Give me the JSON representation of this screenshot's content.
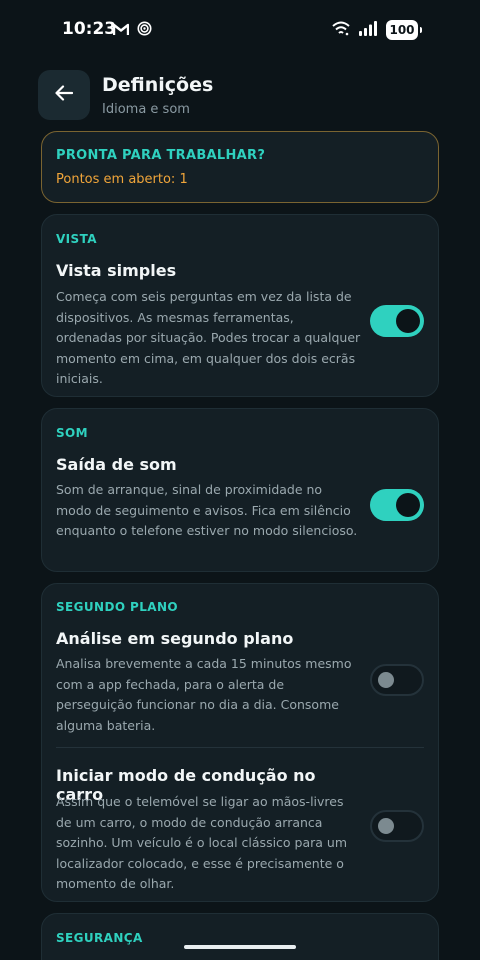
{
  "status_bar": {
    "time": "10:23",
    "battery": "100",
    "icons": [
      "gmail-icon",
      "hotspot-icon",
      "wifi-icon",
      "signal-icon",
      "battery-icon"
    ]
  },
  "header": {
    "back_icon": "arrow-left-icon",
    "title": "Definições",
    "subtitle": "Idioma e som"
  },
  "ready_card": {
    "title": "PRONTA PARA TRABALHAR?",
    "open_points": "Pontos em aberto: 1"
  },
  "sections": {
    "vista": {
      "label": "VISTA",
      "title": "Vista simples",
      "description": "Começa com seis perguntas em vez da lista de dispositivos. As mesmas ferramentas, ordenadas por situação. Podes trocar a qualquer momento em cima, em qualquer dos dois ecrãs iniciais.",
      "enabled": true
    },
    "som": {
      "label": "SOM",
      "title": "Saída de som",
      "description": "Som de arranque, sinal de proximidade no modo de seguimento e avisos. Fica em silêncio enquanto o telefone estiver no modo silencioso.",
      "enabled": true
    },
    "segundo_plano": {
      "label": "SEGUNDO PLANO",
      "items": [
        {
          "title": "Análise em segundo plano",
          "description": "Analisa brevemente a cada 15 minutos mesmo com a app fechada, para o alerta de perseguição funcionar no dia a dia. Consome alguma bateria.",
          "enabled": false
        },
        {
          "title": "Iniciar modo de condução no carro",
          "description": "Assim que o telemóvel se ligar ao mãos-livres de um carro, o modo de condução arranca sozinho. Um veículo é o local clássico para um localizador colocado, e esse é precisamente o momento de olhar.",
          "enabled": false
        }
      ]
    },
    "seguranca": {
      "label": "SEGURANÇA"
    }
  },
  "colors": {
    "background": "#0c1418",
    "card": "#141f25",
    "accent": "#2fd1bf",
    "warning": "#f0a53a",
    "ready_border": "#7a6431"
  }
}
